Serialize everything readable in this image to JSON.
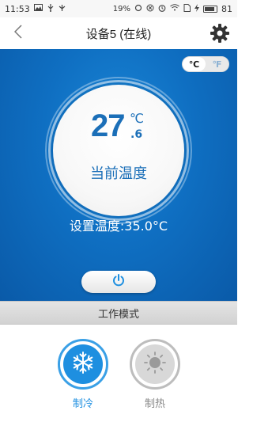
{
  "status_bar": {
    "time": "11:53",
    "battery_percent": "19",
    "battery_symbol": "%",
    "battery_level": "81",
    "icons": [
      "image-icon",
      "usb-icon",
      "usb-debug-icon",
      "sync-icon",
      "close-circle-icon",
      "alarm-icon",
      "wifi-icon",
      "sim-icon",
      "charging-icon",
      "battery-icon"
    ]
  },
  "header": {
    "title": "设备5 (在线)",
    "back_icon": "chevron-left-icon",
    "settings_icon": "gear-icon"
  },
  "unit_toggle": {
    "celsius": "℃",
    "fahrenheit": "℉",
    "selected": "celsius"
  },
  "current_temp": {
    "integer": "27",
    "unit": "℃",
    "decimal": ".6",
    "caption": "当前温度"
  },
  "set_temp": {
    "text": "设置温度:35.0°C"
  },
  "power": {
    "icon": "power-icon",
    "color": "#1e8fe0"
  },
  "mode": {
    "title": "工作模式",
    "items": [
      {
        "label": "制冷",
        "icon": "snowflake-icon",
        "active": true
      },
      {
        "label": "制热",
        "icon": "sun-icon",
        "active": false
      }
    ]
  },
  "colors": {
    "primary": "#1e8fe0",
    "panel": "#0f6fc2",
    "inactive": "#bdbdbd"
  }
}
